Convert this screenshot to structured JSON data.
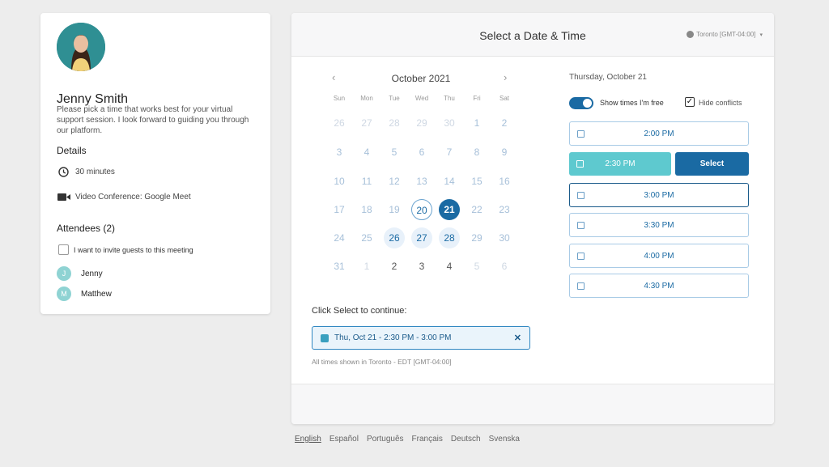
{
  "host": {
    "name": "Jenny Smith",
    "description": "Please pick a time that works best for your virtual support session. I look forward to guiding you through our platform."
  },
  "details": {
    "title": "Details",
    "duration": "30 minutes",
    "location": "Video Conference: Google Meet"
  },
  "attendees": {
    "title": "Attendees (2)",
    "invite_label": "I want to invite guests to this meeting",
    "list": [
      {
        "initial": "J",
        "name": "Jenny"
      },
      {
        "initial": "M",
        "name": "Matthew"
      }
    ]
  },
  "header": {
    "title": "Select a Date & Time",
    "timezone": "Toronto [GMT-04:00]"
  },
  "calendar": {
    "month": "October 2021",
    "prev": "‹",
    "next": "›",
    "weekdays": [
      "Sun",
      "Mon",
      "Tue",
      "Wed",
      "Thu",
      "Fri",
      "Sat"
    ],
    "rows": [
      [
        "26",
        "27",
        "28",
        "29",
        "30",
        "1",
        "2"
      ],
      [
        "3",
        "4",
        "5",
        "6",
        "7",
        "8",
        "9"
      ],
      [
        "10",
        "11",
        "12",
        "13",
        "14",
        "15",
        "16"
      ],
      [
        "17",
        "18",
        "19",
        "20",
        "21",
        "22",
        "23"
      ],
      [
        "24",
        "25",
        "26",
        "27",
        "28",
        "29",
        "30"
      ],
      [
        "31",
        "1",
        "2",
        "3",
        "4",
        "5",
        "6"
      ]
    ]
  },
  "selection": {
    "prompt": "Click Select to continue:",
    "summary": "Thu, Oct 21 - 2:30 PM - 3:00 PM",
    "remove": "✕",
    "note": "All times shown in Toronto - EDT [GMT-04:00]"
  },
  "times": {
    "date_heading": "Thursday, October 21",
    "toggle_label": "Show times I'm free",
    "toggle_on": true,
    "hide_conflicts_label": "Hide conflicts",
    "hide_conflicts_checked": true,
    "slots": [
      "2:00 PM",
      "2:30 PM",
      "3:00 PM",
      "3:30 PM",
      "4:00 PM",
      "4:30 PM"
    ],
    "selected_slot": "2:30 PM",
    "select_label": "Select"
  },
  "languages": [
    "English",
    "Español",
    "Português",
    "Français",
    "Deutsch",
    "Svenska"
  ]
}
